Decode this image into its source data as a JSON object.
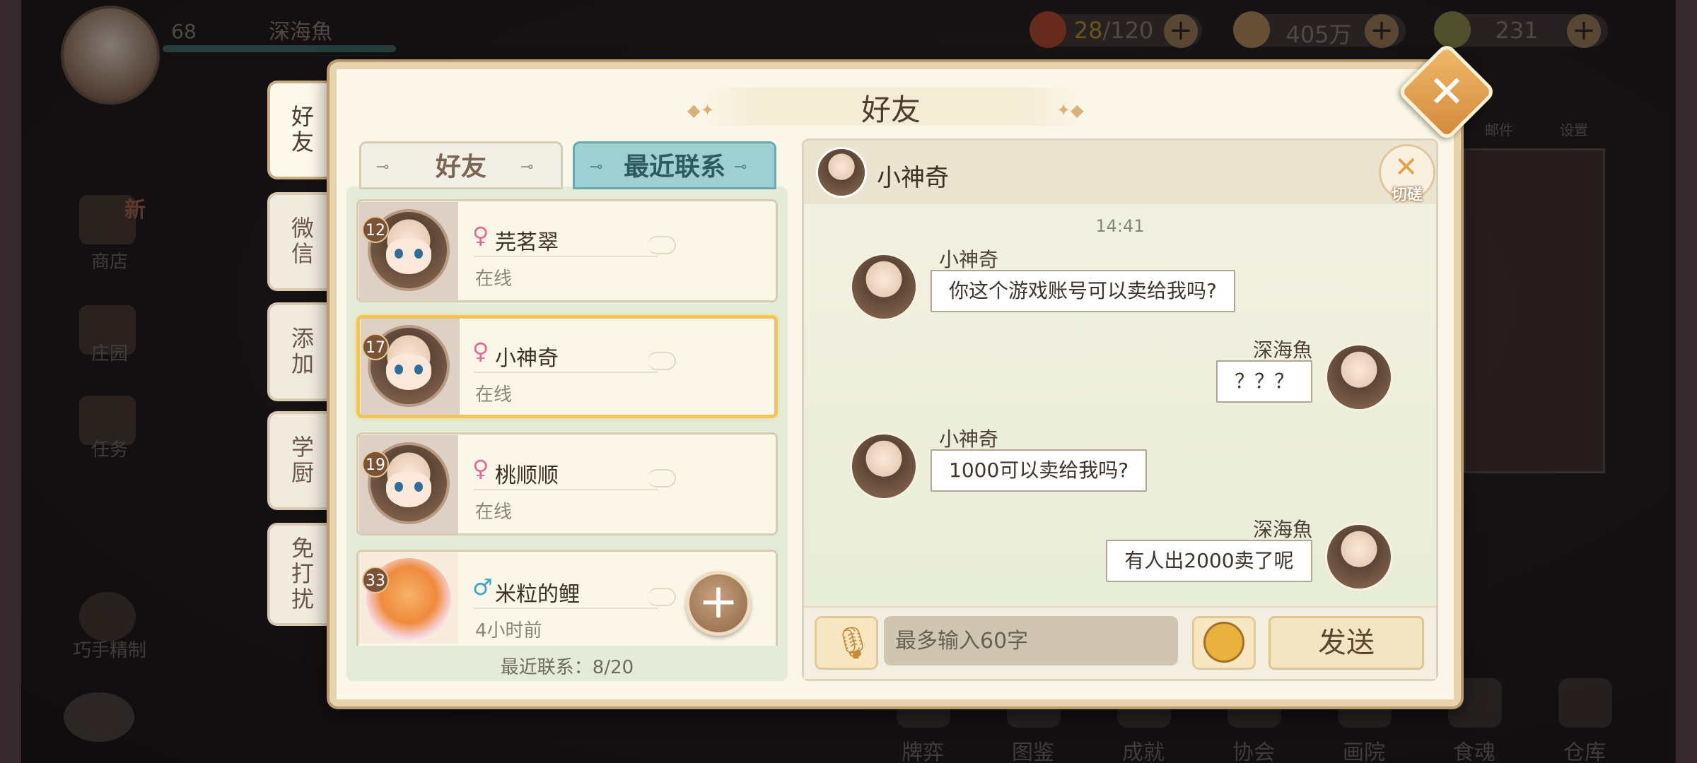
{
  "player": {
    "level": "68",
    "name": "深海魚"
  },
  "resources": [
    {
      "icon": "rice-bowl-icon",
      "value": "28",
      "max": "/120"
    },
    {
      "icon": "coin-icon",
      "value": "405万"
    },
    {
      "icon": "gem-icon",
      "value": "231"
    }
  ],
  "left_menu": [
    "商店",
    "庄园",
    "任务",
    "巧手精制"
  ],
  "left_badge": "新",
  "bottom_nav": [
    "牌弈",
    "图鉴",
    "成就",
    "协会",
    "画院",
    "食魂",
    "仓库"
  ],
  "top_right": [
    "邮件",
    "设置"
  ],
  "dialog": {
    "title": "好友",
    "side_tabs": [
      "好友",
      "微信",
      "添加",
      "学厨",
      "免打扰"
    ],
    "tabs": {
      "friends": "好友",
      "recent": "最近联系"
    },
    "friends": [
      {
        "level": "12",
        "gender": "♀",
        "name": "芫茗翠",
        "status": "在线"
      },
      {
        "level": "17",
        "gender": "♀",
        "name": "小神奇",
        "status": "在线"
      },
      {
        "level": "19",
        "gender": "♀",
        "name": "桃顺顺",
        "status": "在线"
      },
      {
        "level": "33",
        "gender": "♂",
        "name": "米粒的鲤",
        "status": "4小时前"
      }
    ],
    "recent_count": "最近联系：8/20",
    "chat": {
      "header_name": "小神奇",
      "switch_label": "切磋",
      "time": "14:41",
      "messages": [
        {
          "sender": "小神奇",
          "text": "你这个游戏账号可以卖给我吗?",
          "side": "left"
        },
        {
          "sender": "深海魚",
          "text": "？？？",
          "side": "right"
        },
        {
          "sender": "小神奇",
          "text": "1000可以卖给我吗?",
          "side": "left"
        },
        {
          "sender": "深海魚",
          "text": "有人出2000卖了呢",
          "side": "right"
        }
      ],
      "input_placeholder": "最多输入60字",
      "send_label": "发送"
    }
  },
  "colors": {
    "accent_tab": "#9ed0d2",
    "selected_border": "#f0c45a",
    "female": "#e06c9a",
    "male": "#3fa6c8"
  }
}
